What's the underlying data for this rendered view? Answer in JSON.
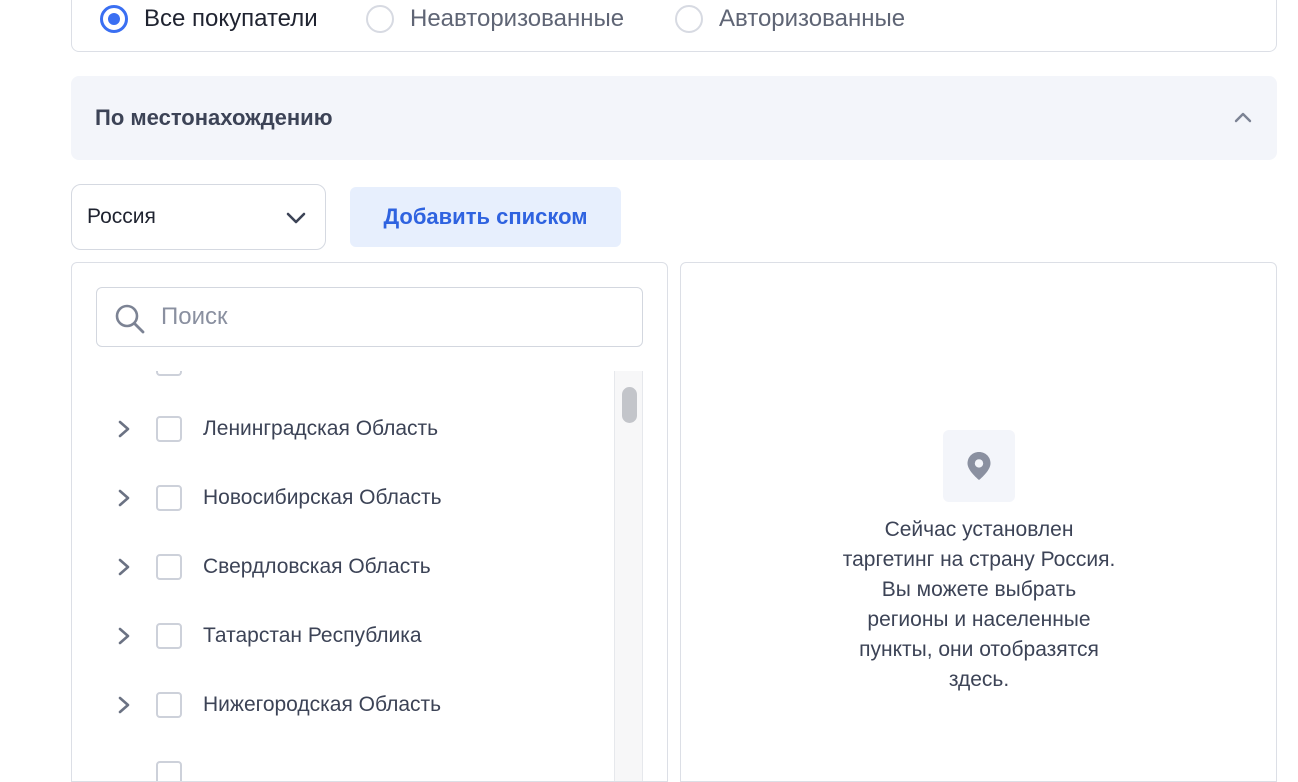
{
  "audience": {
    "options": [
      {
        "label": "Все покупатели",
        "checked": true
      },
      {
        "label": "Неавторизованные",
        "checked": false
      },
      {
        "label": "Авторизованные",
        "checked": false
      }
    ]
  },
  "location_section": {
    "title": "По местонахождению",
    "expanded": true,
    "toggle_icon": "chevron-up-icon"
  },
  "country_select": {
    "value": "Россия",
    "icon": "chevron-down-icon"
  },
  "add_list_button": {
    "label": "Добавить списком"
  },
  "search": {
    "placeholder": "Поиск",
    "value": "",
    "icon": "search-icon"
  },
  "regions": [
    {
      "label": "Ленинградская Область",
      "checked": false
    },
    {
      "label": "Новосибирская Область",
      "checked": false
    },
    {
      "label": "Свердловская Область",
      "checked": false
    },
    {
      "label": "Татарстан Республика",
      "checked": false
    },
    {
      "label": "Нижегородская Область",
      "checked": false
    }
  ],
  "selected_panel": {
    "icon": "location-pin-icon",
    "empty_message": "Сейчас установлен\nтаргетинг на страну Россия.\nВы можете выбрать\nрегионы и населенные\nпункты, они отобразятся\nздесь."
  },
  "colors": {
    "accent": "#3a6ff2",
    "button_bg": "#e7effd",
    "header_bg": "#f3f5fa",
    "text": "#3c4356"
  }
}
